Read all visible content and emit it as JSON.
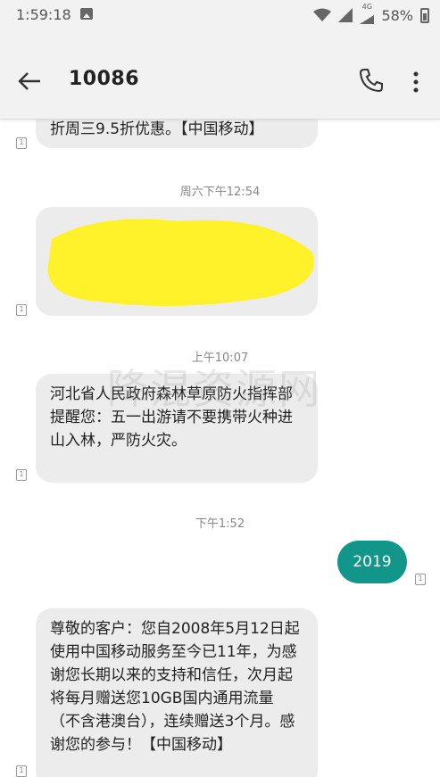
{
  "status_bar": {
    "time": "1:59:18",
    "battery_percent": "58%",
    "network_tag": "4G"
  },
  "header": {
    "title": "10086"
  },
  "messages": [
    {
      "text": "折周三9.5折优惠。【中国移动】"
    },
    {
      "timestamp": "周六下午12:54"
    },
    {
      "timestamp": "上午10:07"
    },
    {
      "text": "河北省人民政府森林草原防火指挥部提醒您：五一出游请不要携带火种进山入林，严防火灾。"
    },
    {
      "timestamp": "下午1:52"
    },
    {
      "text": "2019"
    },
    {
      "text": "尊敬的客户：您自2008年5月12日起使用中国移动服务至今已11年，为感谢您长期以来的支持和信任，次月起将每月赠送您10GB国内通用流量（不含港澳台），连续赠送3个月。感谢您的参与！【中国移动】"
    }
  ],
  "sim_label": "1",
  "watermark": "降混资源网",
  "colors": {
    "incoming_bubble": "#ececec",
    "outgoing_bubble": "#13968a",
    "redaction": "#fff12a"
  }
}
